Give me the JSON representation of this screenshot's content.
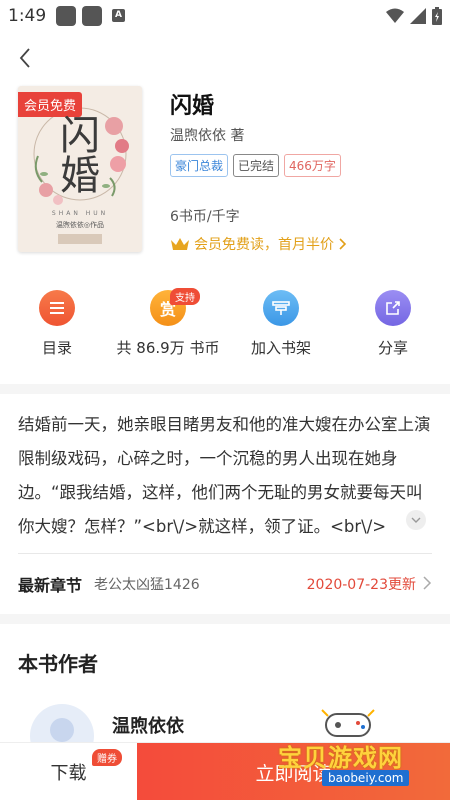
{
  "status_bar": {
    "time": "1:49"
  },
  "book": {
    "cover_badge": "会员免费",
    "cover_title": "闪婚",
    "cover_pinyin": "SHAN HUN",
    "cover_author": "温煦依依◎作品",
    "title": "闪婚",
    "author": "温煦依依 著",
    "tags": [
      "豪门总裁",
      "已完结",
      "466万字"
    ],
    "price": "6书币/千字",
    "vip_text": "会员免费读，首月半价"
  },
  "actions": {
    "catalog": "目录",
    "reward": "共 86.9万 书币",
    "reward_icon": "赏",
    "support_badge": "支持",
    "add_shelf": "加入书架",
    "share": "分享"
  },
  "intro": {
    "text": "结婚前一天，她亲眼目睹男友和他的准大嫂在办公室上演限制级戏码，心碎之时，一个沉稳的男人出现在她身边。“跟我结婚，这样，他们两个无耻的男女就要每天叫你大嫂？怎样？”<br\\/>就这样，领了证。<br\\/>"
  },
  "latest": {
    "label": "最新章节",
    "chapter": "老公太凶猛1426",
    "date": "2020-07-23更新"
  },
  "author_section": {
    "heading": "本书作者",
    "name": "温煦依依"
  },
  "bottom": {
    "download": "下载",
    "gift_badge": "赠券",
    "read": "立即阅读"
  },
  "watermark": {
    "text": "宝贝游戏网",
    "url": "baobeiy.com"
  },
  "colors": {
    "accent": "#f44b3b",
    "vip": "#e2a019",
    "tag_blue": "#3b86d9"
  }
}
